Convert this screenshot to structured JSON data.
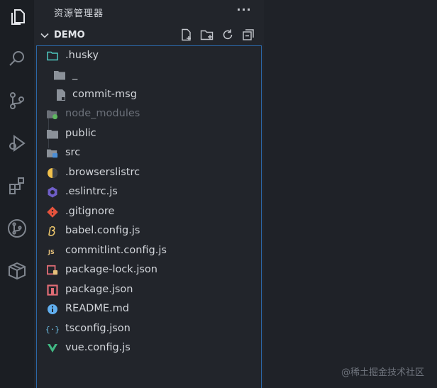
{
  "sidebar": {
    "title": "资源管理器",
    "more_label": "···",
    "section_title": "DEMO"
  },
  "tree": {
    "items": [
      {
        "label": "husky",
        "prefix": ".",
        "icon": "folder-husky-icon",
        "depth": 0
      },
      {
        "label": "_",
        "icon": "folder-icon",
        "depth": 1
      },
      {
        "label": "commit-msg",
        "icon": "file-icon",
        "depth": 1
      },
      {
        "label": "node_modules",
        "icon": "folder-node-icon",
        "depth": 0,
        "dimmed": true
      },
      {
        "label": "public",
        "icon": "folder-icon",
        "depth": 0
      },
      {
        "label": "src",
        "icon": "folder-src-icon",
        "depth": 0
      },
      {
        "label": ".browserslistrc",
        "icon": "browserslist-icon",
        "depth": 0
      },
      {
        "label": ".eslintrc.js",
        "icon": "eslint-icon",
        "depth": 0
      },
      {
        "label": ".gitignore",
        "icon": "git-icon",
        "depth": 0
      },
      {
        "label": "babel.config.js",
        "icon": "babel-icon",
        "depth": 0
      },
      {
        "label": "commitlint.config.js",
        "icon": "js-icon",
        "depth": 0
      },
      {
        "label": "package-lock.json",
        "icon": "npm-lock-icon",
        "depth": 0
      },
      {
        "label": "package.json",
        "icon": "npm-icon",
        "depth": 0
      },
      {
        "label": "README.md",
        "icon": "info-icon",
        "depth": 0
      },
      {
        "label": "tsconfig.json",
        "icon": "json-icon",
        "depth": 0
      },
      {
        "label": "vue.config.js",
        "icon": "vue-icon",
        "depth": 0
      }
    ]
  },
  "watermark": "@稀土掘金技术社区",
  "colors": {
    "accent_border": "#2b67a8",
    "folder": "#8b9199",
    "husky_folder": "#4ec9c0",
    "vue_green": "#41b883",
    "git_red": "#e5533d",
    "npm_red": "#e06c75",
    "js_yellow": "#e5c07b",
    "info_blue": "#61afef"
  }
}
